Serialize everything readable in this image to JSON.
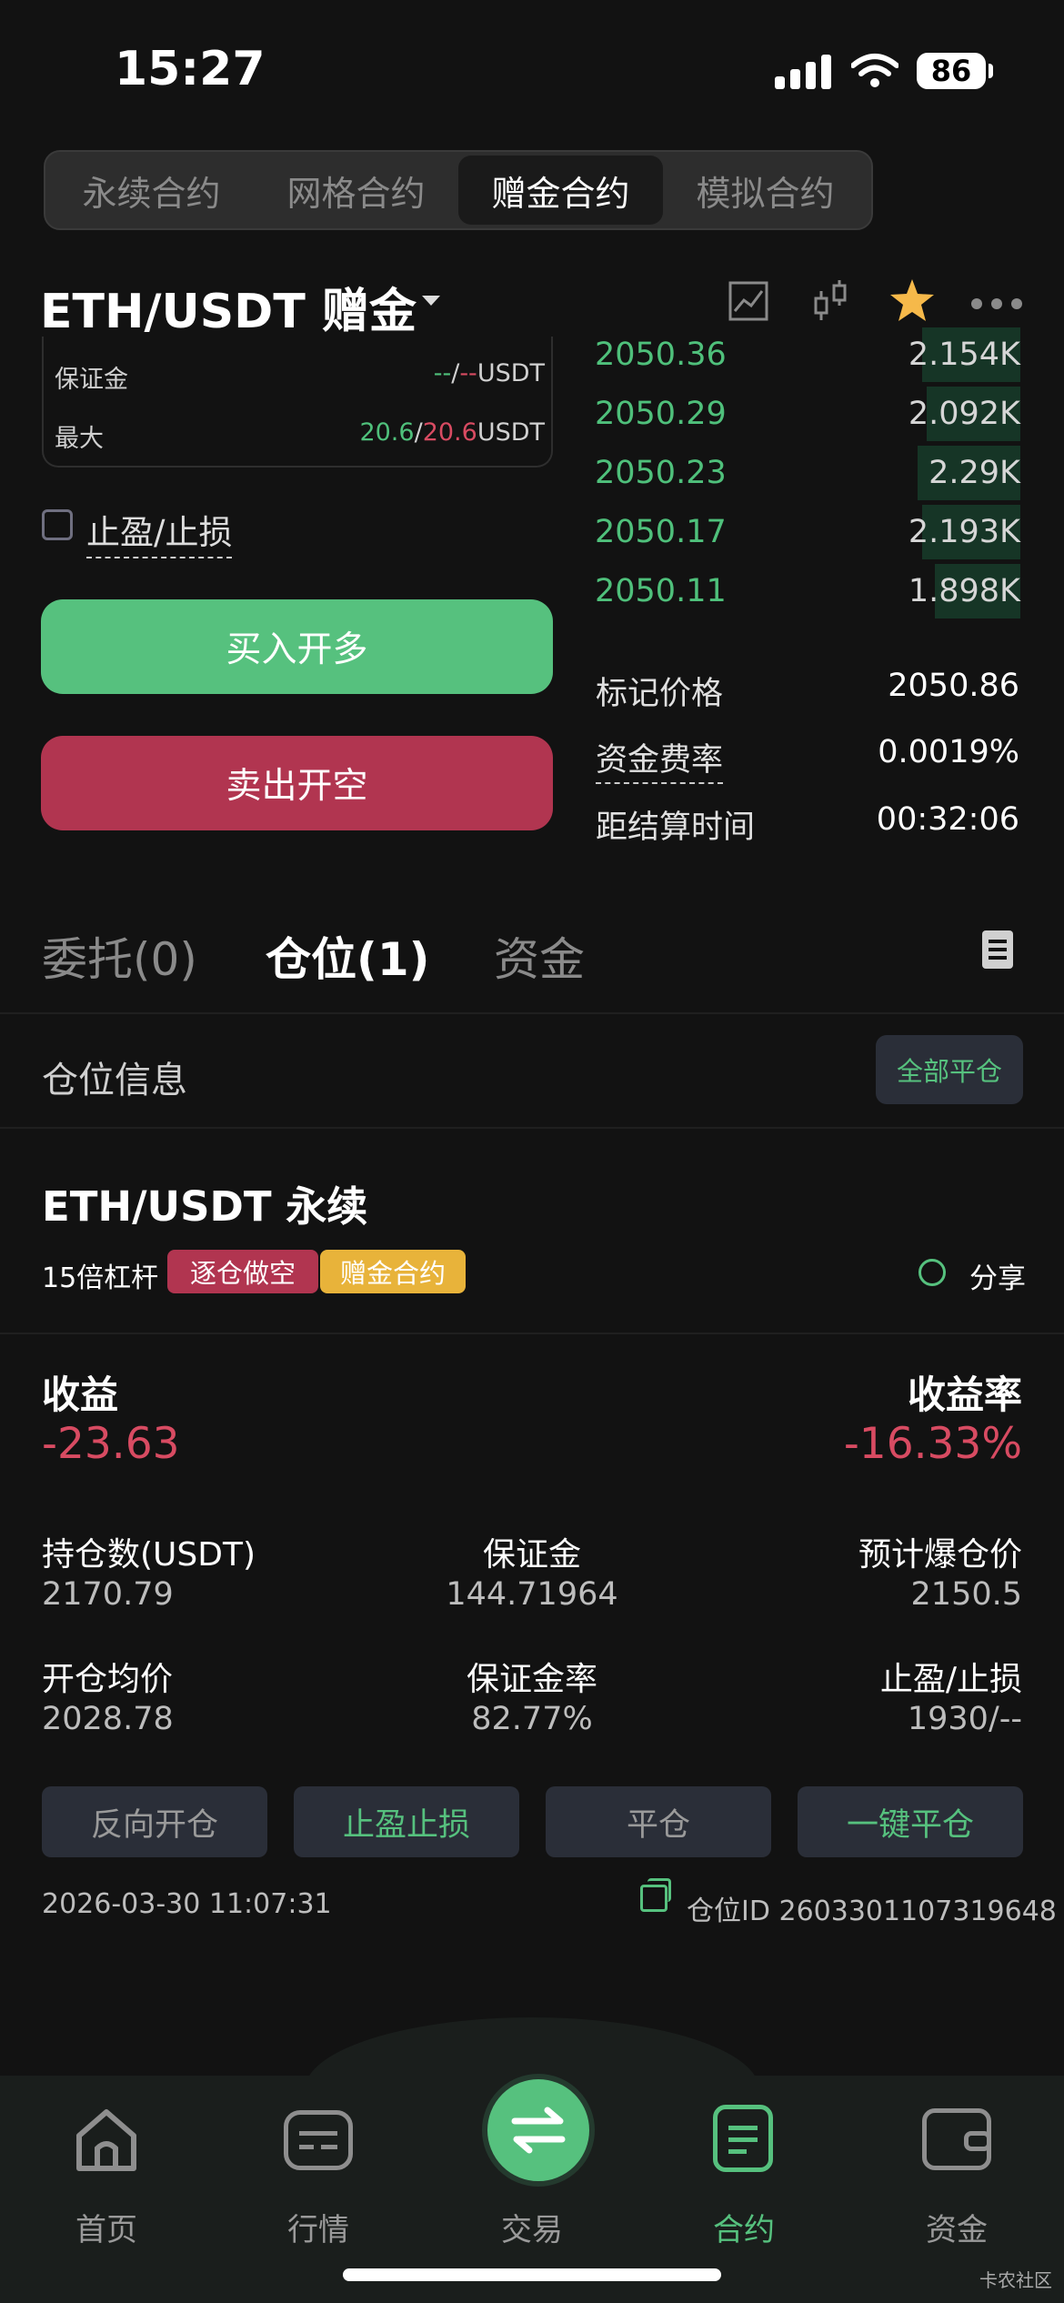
{
  "status": {
    "time": "15:27",
    "battery": "86"
  },
  "segments": [
    "永续合约",
    "网格合约",
    "赠金合约",
    "模拟合约"
  ],
  "active_segment": 2,
  "pair": {
    "title": "ETH/USDT 赠金"
  },
  "leverage_box": {
    "margin_label": "保证金",
    "margin_value_a": "--",
    "margin_sep": "/",
    "margin_value_b": "--",
    "margin_unit": "USDT",
    "max_label": "最大",
    "max_value_a": "20.6",
    "max_sep": "/",
    "max_value_b": "20.6",
    "max_unit": "USDT"
  },
  "tp_sl_label": "止盈/止损",
  "buy_label": "买入开多",
  "sell_label": "卖出开空",
  "order_book": [
    {
      "price": "2050.36",
      "qty": "2.154K",
      "depth": 0.23
    },
    {
      "price": "2050.29",
      "qty": "2.092K",
      "depth": 0.22
    },
    {
      "price": "2050.23",
      "qty": "2.29K",
      "depth": 0.24
    },
    {
      "price": "2050.17",
      "qty": "2.193K",
      "depth": 0.23
    },
    {
      "price": "2050.11",
      "qty": "1.898K",
      "depth": 0.2
    }
  ],
  "market_info": {
    "mark_label": "标记价格",
    "mark_value": "2050.86",
    "funding_label": "资金费率",
    "funding_value": "0.0019%",
    "settle_label": "距结算时间",
    "settle_value": "00:32:06"
  },
  "tabs": [
    "委托(0)",
    "仓位(1)",
    "资金"
  ],
  "active_tab": 1,
  "position_info_label": "仓位信息",
  "close_all_label": "全部平仓",
  "position": {
    "pair": "ETH/USDT 永续",
    "leverage": "15倍杠杆",
    "tag_short": "逐仓做空",
    "tag_bonus": "赠金合约",
    "share": "分享",
    "pnl_label": "收益",
    "pnl_value": "-23.63",
    "pnl_rate_label": "收益率",
    "pnl_rate_value": "-16.33%",
    "stats": [
      {
        "label": "持仓数(USDT)",
        "value": "2170.79"
      },
      {
        "label": "保证金",
        "value": "144.71964"
      },
      {
        "label": "预计爆仓价",
        "value": "2150.5"
      },
      {
        "label": "开仓均价",
        "value": "2028.78"
      },
      {
        "label": "保证金率",
        "value": "82.77%"
      },
      {
        "label": "止盈/止损",
        "value": "1930/--"
      }
    ],
    "actions": [
      "反向开仓",
      "止盈止损",
      "平仓",
      "一键平仓"
    ],
    "open_time": "2026-03-30 11:07:31",
    "position_id": "仓位ID 2603301107319648"
  },
  "nav": [
    "首页",
    "行情",
    "交易",
    "合约",
    "资金"
  ],
  "active_nav": 3,
  "colors": {
    "green": "#56c17e",
    "red": "#d84b62",
    "bg": "#121212"
  },
  "watermark": "卡农社区"
}
